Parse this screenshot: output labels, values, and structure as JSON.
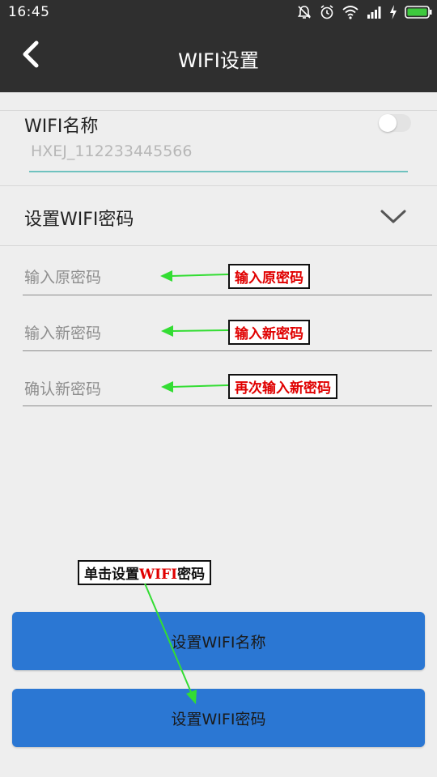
{
  "status_bar": {
    "time": "16:45",
    "icons": [
      "alarm-off-icon",
      "alarm-clock-icon",
      "wifi-signal-icon",
      "cell-signal-icon",
      "charging-icon",
      "battery-icon"
    ]
  },
  "toolbar": {
    "back_icon": "chevron-left-icon",
    "title": "WIFI设置"
  },
  "wifi_name": {
    "label": "WIFI名称",
    "value": "HXEJ_112233445566",
    "toggle_on": false
  },
  "password_section": {
    "label": "设置WIFI密码",
    "expand_icon": "chevron-down-icon",
    "fields": [
      {
        "placeholder": "输入原密码"
      },
      {
        "placeholder": "输入新密码"
      },
      {
        "placeholder": "确认新密码"
      }
    ]
  },
  "annotations": {
    "old_pw": "输入原密码",
    "new_pw": "输入新密码",
    "confirm_pw": "再次输入新密码",
    "click_prefix": "单击设置",
    "click_highlight": "WIFI",
    "click_suffix": "密码"
  },
  "buttons": {
    "set_name": "设置WIFI名称",
    "set_password": "设置WIFI密码"
  },
  "colors": {
    "bar_background": "#2f2f2f",
    "page_background": "#eeeeee",
    "button_blue": "#2b77d3",
    "input_accent": "#6fc2bf",
    "annotation_red": "#e00000",
    "arrow_green": "#33dd33"
  }
}
